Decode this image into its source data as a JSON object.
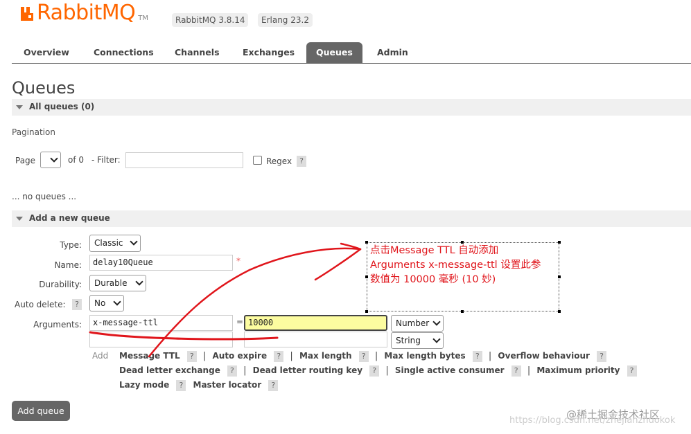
{
  "header": {
    "logo_text_rabbit": "Rabbit",
    "logo_text_mq": "MQ",
    "logo_tm": "TM",
    "rabbit_version": "RabbitMQ 3.8.14",
    "erlang_version": "Erlang 23.2"
  },
  "nav": {
    "tabs": [
      {
        "label": "Overview"
      },
      {
        "label": "Connections"
      },
      {
        "label": "Channels"
      },
      {
        "label": "Exchanges"
      },
      {
        "label": "Queues",
        "active": true
      },
      {
        "label": "Admin"
      }
    ]
  },
  "page_title": "Queues",
  "all_queues": {
    "label": "All queues (0)"
  },
  "pagination": {
    "section_label": "Pagination",
    "page_label": "Page",
    "of_label": "of 0",
    "filter_label": "- Filter:",
    "filter_value": "",
    "regex_label": "Regex",
    "help": "?"
  },
  "no_queues": "... no queues ...",
  "add_queue_section": {
    "label": "Add a new queue",
    "type_label": "Type:",
    "type_value": "Classic",
    "name_label": "Name:",
    "name_value": "delay10Queue",
    "required_mark": "*",
    "durability_label": "Durability:",
    "durability_value": "Durable",
    "auto_delete_label": "Auto delete:",
    "auto_delete_help": "?",
    "auto_delete_value": "No",
    "arguments_label": "Arguments:",
    "arg1_key": "x-message-ttl",
    "equals": "=",
    "arg1_value": "10000",
    "arg1_type": "Number",
    "arg2_key": "",
    "arg2_value": "",
    "arg2_type": "String",
    "add_label": "Add",
    "options_row1": [
      {
        "label": "Message TTL"
      },
      {
        "label": "Auto expire"
      },
      {
        "label": "Max length"
      },
      {
        "label": "Max length bytes"
      },
      {
        "label": "Overflow behaviour"
      }
    ],
    "options_row2": [
      {
        "label": "Dead letter exchange"
      },
      {
        "label": "Dead letter routing key"
      },
      {
        "label": "Single active consumer"
      },
      {
        "label": "Maximum priority"
      }
    ],
    "options_row3": [
      {
        "label": "Lazy mode"
      },
      {
        "label": "Master locator"
      }
    ],
    "help": "?",
    "separator": "|",
    "submit_label": "Add queue"
  },
  "annotation": {
    "line1": "点击Message TTL 自动添加",
    "line2": "Arguments  x-message-ttl 设置此参",
    "line3": "数值为 10000 毫秒 (10 妙)",
    "color": "#e0151b"
  },
  "watermark": {
    "site": "@稀土掘金技术社区",
    "url": "https://blog.csdn.net/zhejianzhuokok"
  }
}
